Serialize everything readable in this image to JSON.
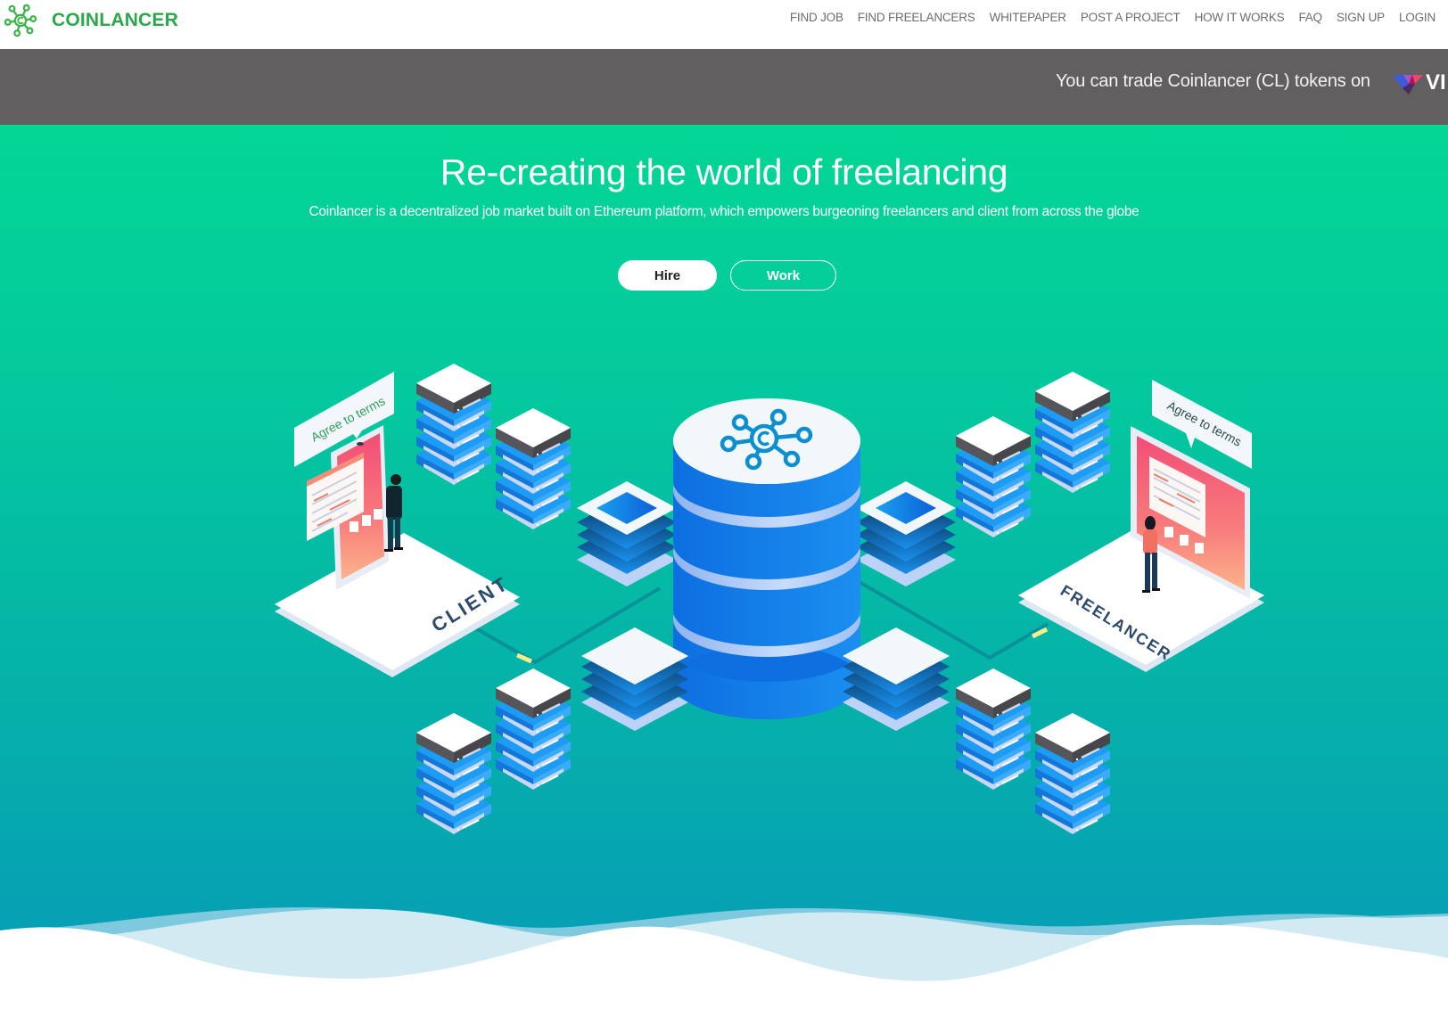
{
  "navbar": {
    "brand_name": "COINLANCER",
    "brand_color": "#2aa84a",
    "logo_icon": "network-coin-icon",
    "links": [
      {
        "label": "FIND JOB"
      },
      {
        "label": "FIND FREELANCERS"
      },
      {
        "label": "WHITEPAPER"
      },
      {
        "label": "POST A PROJECT"
      },
      {
        "label": "HOW IT WORKS"
      },
      {
        "label": "FAQ"
      },
      {
        "label": "SIGN UP"
      },
      {
        "label": "LOGIN"
      }
    ]
  },
  "announcement": {
    "text": "You can trade Coinlancer (CL) tokens on",
    "exchange_name_visible": "VI",
    "exchange_icon": "exchange-v-logo-icon",
    "background": "#615f60"
  },
  "hero": {
    "title": "Re-creating the world of freelancing",
    "subtitle": "Coinlancer is a decentralized job market built on Ethereum platform, which empowers burgeoning freelancers and client from across the globe",
    "hire_label": "Hire",
    "work_label": "Work",
    "gradient_top": "#03d695",
    "gradient_bottom": "#0799b9"
  },
  "illustration": {
    "client_platform_label": "CLIENT",
    "freelancer_platform_label": "FREELANCER",
    "client_bubble": "Agree to terms",
    "freelancer_bubble": "Agree to terms",
    "center_icon": "coinlancer-network-icon",
    "server_blue": "#1e9bf5",
    "database_blue": "#0d6fe0"
  }
}
